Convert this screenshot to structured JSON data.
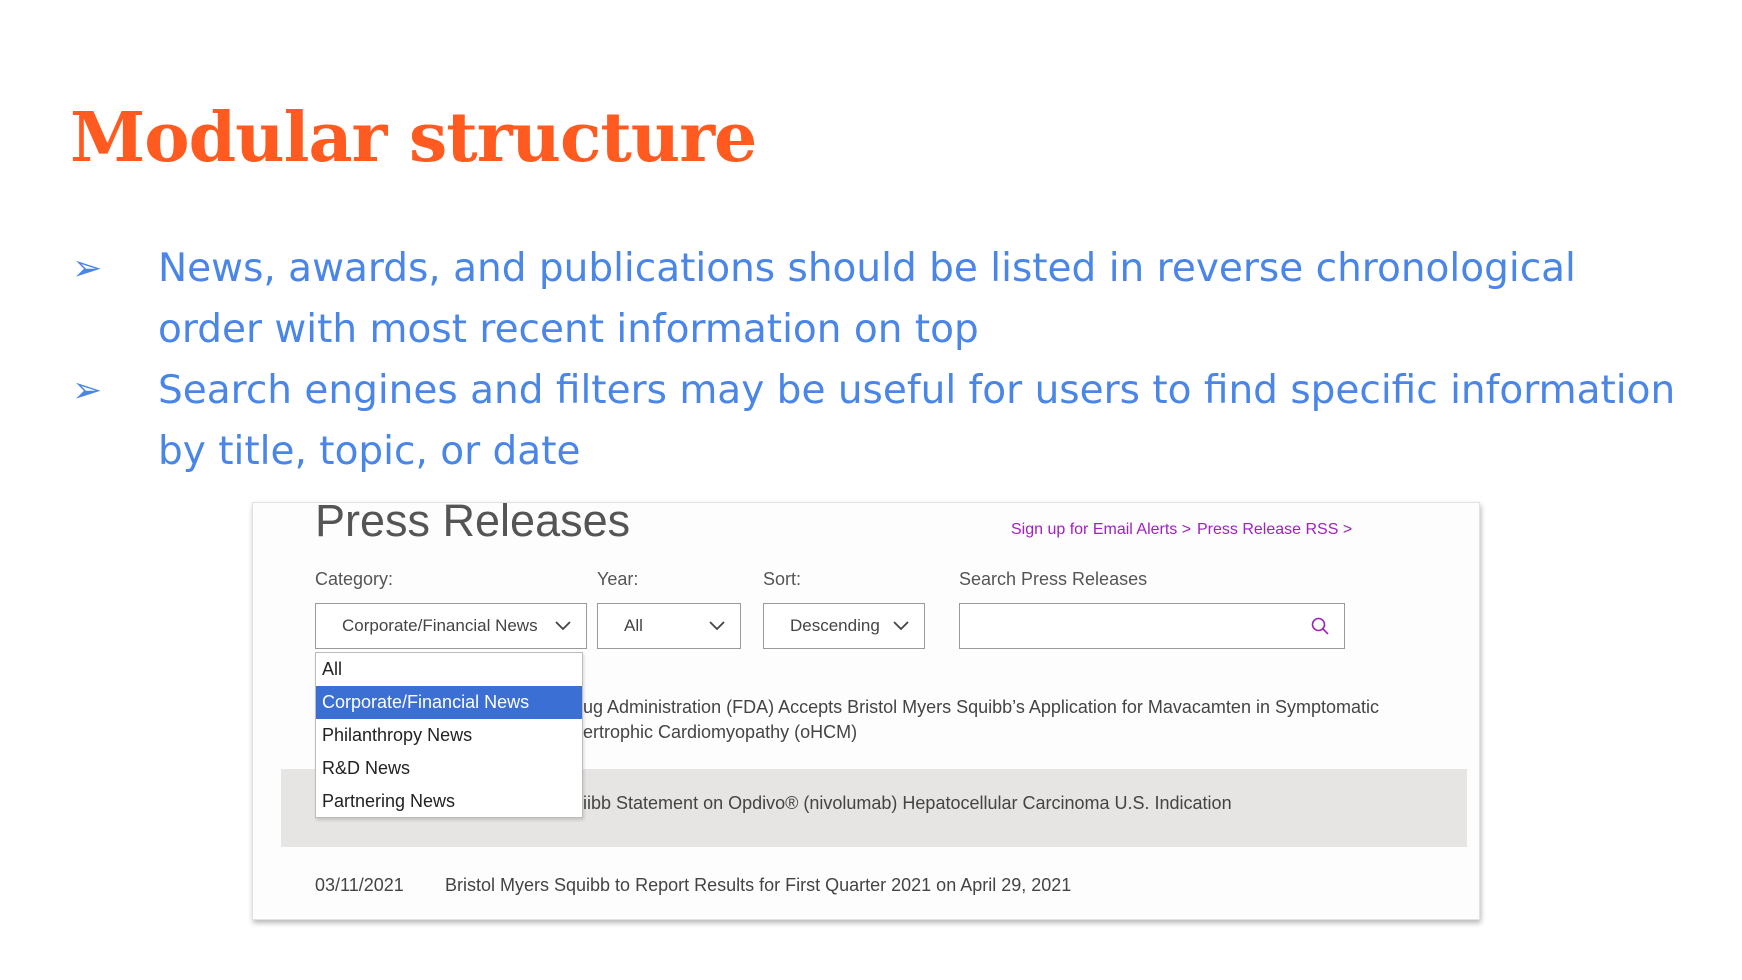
{
  "slide": {
    "title": "Modular structure",
    "bullets": [
      "News, awards, and publications should be listed in reverse chronological order with most recent information on top",
      "Search engines and filters may be useful for users to find specific information by title, topic, or date"
    ],
    "bullet_glyph": "➢",
    "colors": {
      "title": "#ff5a1f",
      "bullets": "#4a86e8"
    }
  },
  "screenshot": {
    "heading": "Press Releases",
    "links": {
      "email_alerts": "Sign up for Email Alerts  >",
      "rss": "Press Release RSS  >"
    },
    "filters": {
      "category": {
        "label": "Category:",
        "value": "Corporate/Financial News",
        "options": [
          "All",
          "Corporate/Financial News",
          "Philanthropy News",
          "R&D News",
          "Partnering News"
        ]
      },
      "year": {
        "label": "Year:",
        "value": "All"
      },
      "sort": {
        "label": "Sort:",
        "value": "Descending"
      },
      "search": {
        "label": "Search Press Releases",
        "placeholder": ""
      }
    },
    "releases": [
      {
        "title_line1": "ug Administration (FDA) Accepts Bristol Myers Squibb’s Application for Mavacamten in Symptomatic",
        "title_line2": "ertrophic Cardiomyopathy (oHCM)"
      },
      {
        "title": "iibb Statement on Opdivo® (nivolumab) Hepatocellular Carcinoma U.S. Indication"
      },
      {
        "date": "03/11/2021",
        "title": "Bristol Myers Squibb to Report Results for First Quarter 2021 on April 29, 2021"
      }
    ],
    "colors": {
      "link": "#a020c0",
      "selected_option": "#3b6fd4"
    },
    "icons": {
      "dropdown": "chevron-down-icon",
      "search": "search-icon"
    }
  }
}
